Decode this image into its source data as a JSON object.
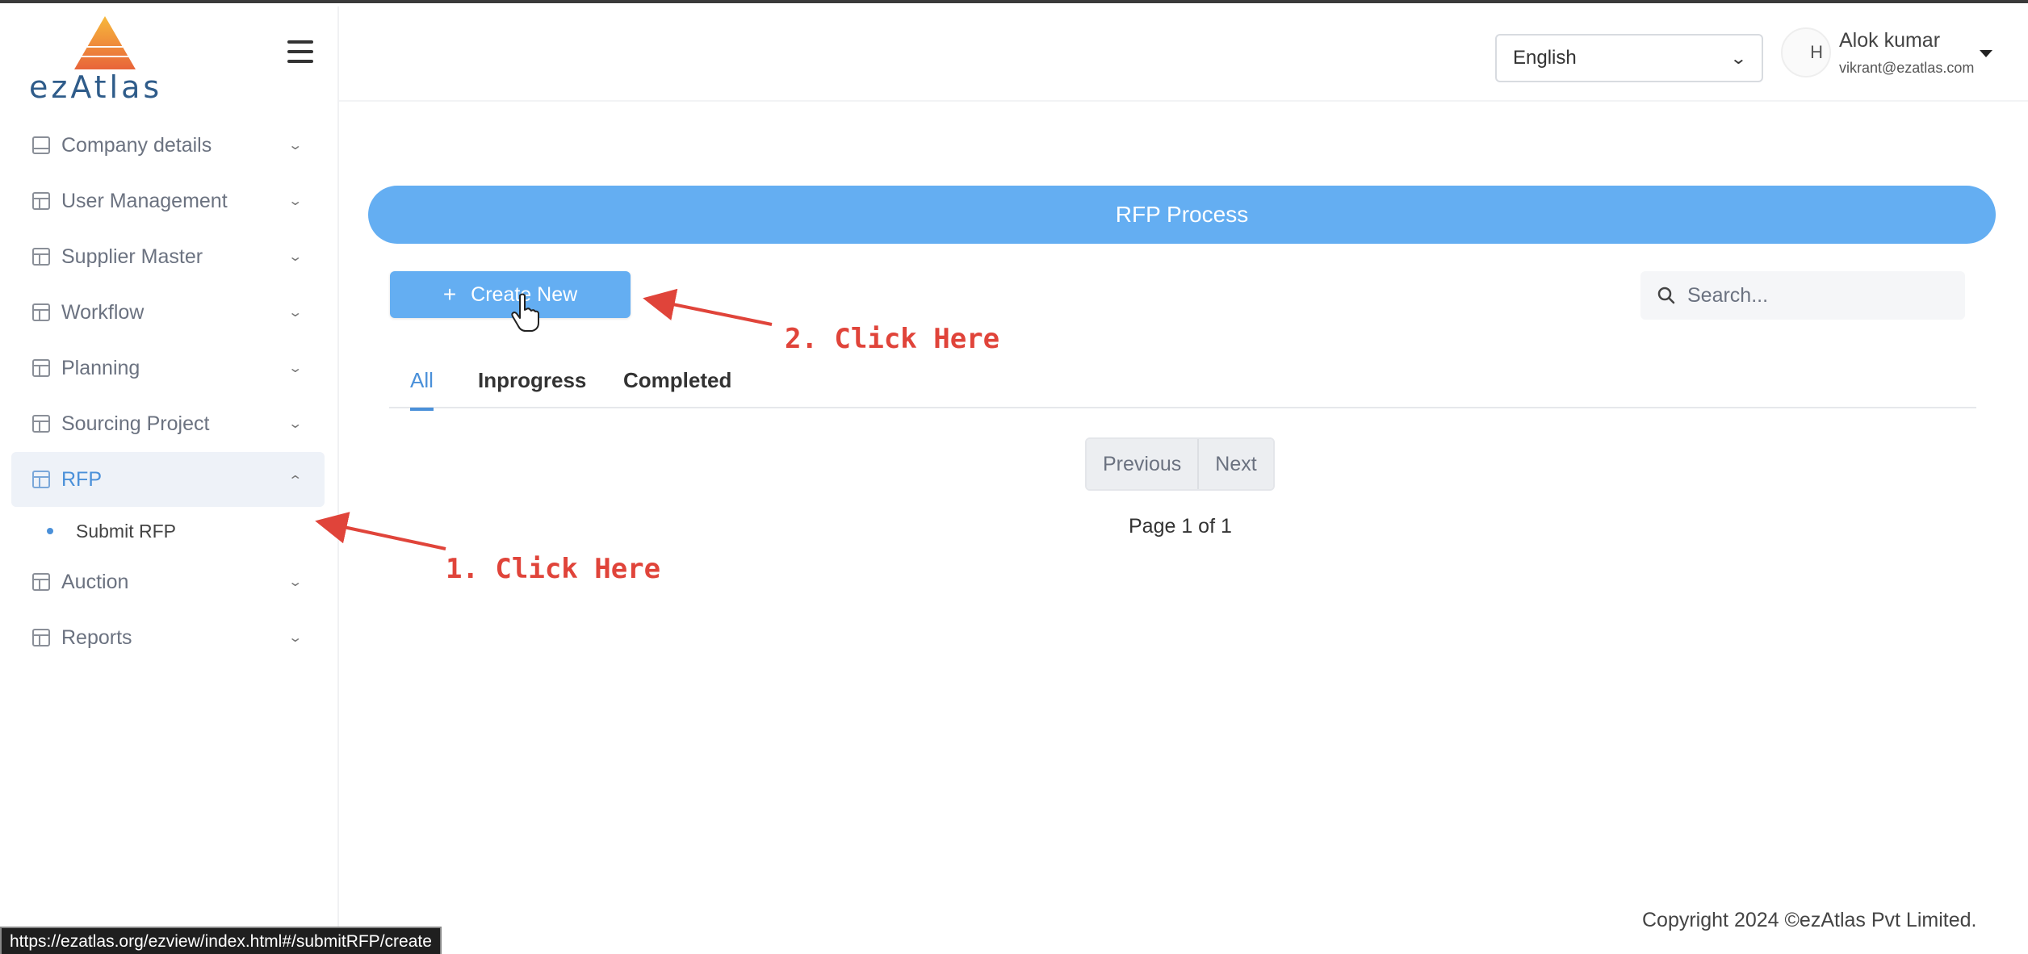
{
  "app": {
    "logo_text": "ezAtlas"
  },
  "sidebar": {
    "items": [
      {
        "label": "Company details",
        "icon": "book-icon"
      },
      {
        "label": "User Management",
        "icon": "table-icon"
      },
      {
        "label": "Supplier Master",
        "icon": "table-icon"
      },
      {
        "label": "Workflow",
        "icon": "table-icon"
      },
      {
        "label": "Planning",
        "icon": "table-icon"
      },
      {
        "label": "Sourcing Project",
        "icon": "table-icon"
      },
      {
        "label": "RFP",
        "icon": "table-icon",
        "expanded": true
      },
      {
        "label": "Auction",
        "icon": "table-icon"
      },
      {
        "label": "Reports",
        "icon": "table-icon"
      }
    ],
    "submenu": {
      "label": "Submit RFP"
    }
  },
  "header": {
    "language": "English",
    "user_name": "Alok kumar",
    "user_email": "vikrant@ezatlas.com",
    "avatar_alt": "H"
  },
  "main": {
    "banner_title": "RFP Process",
    "create_label": "Create New",
    "search_placeholder": "Search...",
    "tabs": [
      {
        "label": "All",
        "active": true
      },
      {
        "label": "Inprogress"
      },
      {
        "label": "Completed"
      }
    ],
    "pager": {
      "previous": "Previous",
      "next": "Next",
      "page_info": "Page 1 of 1"
    }
  },
  "annotations": {
    "step1": "1. Click Here",
    "step2": "2. Click Here",
    "color": "#e0443a"
  },
  "footer": {
    "copyright": "Copyright 2024 ©ezAtlas Pvt Limited."
  },
  "status_bar": {
    "url": "https://ezatlas.org/ezview/index.html#/submitRFP/create"
  },
  "colors": {
    "accent": "#64aef2",
    "active_text": "#4a90d9"
  }
}
